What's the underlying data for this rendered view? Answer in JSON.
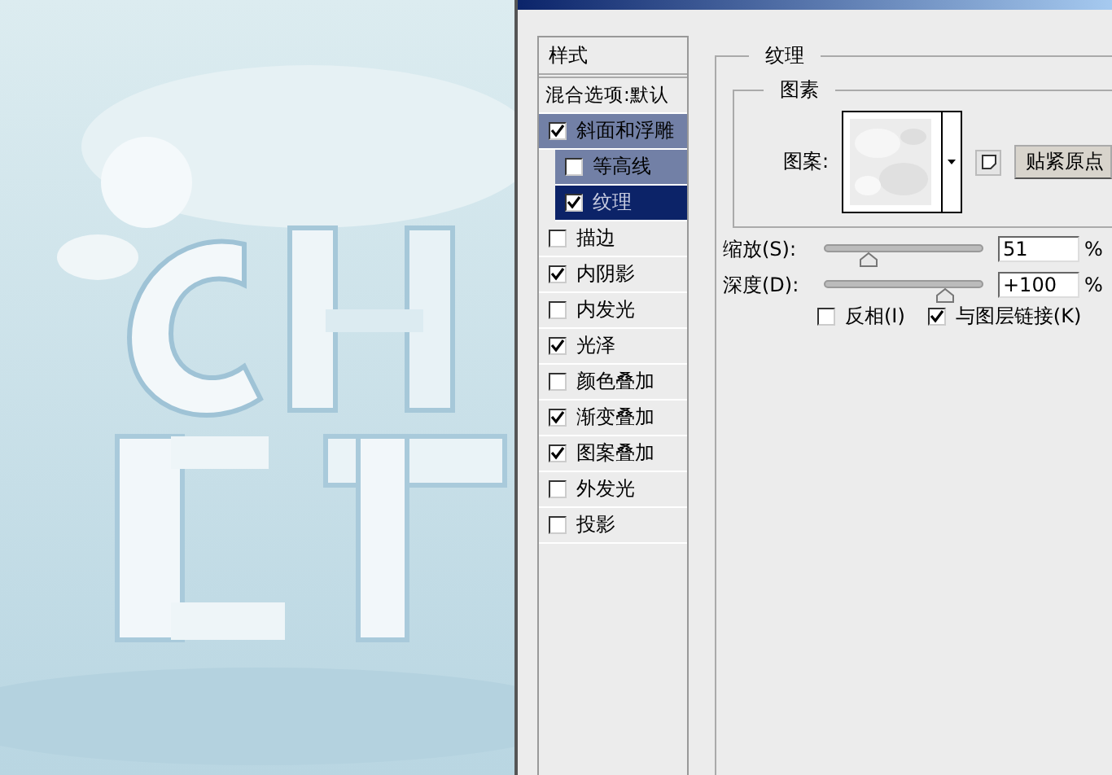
{
  "style_list": {
    "header": "样式",
    "items": [
      {
        "label": "混合选项:默认",
        "kind": "plain",
        "selected": false
      },
      {
        "label": "斜面和浮雕",
        "kind": "checkbox",
        "checked": true,
        "selected": false,
        "children": [
          {
            "label": "等高线",
            "kind": "checkbox",
            "checked": false,
            "selected": false
          },
          {
            "label": "纹理",
            "kind": "checkbox",
            "checked": true,
            "selected": true
          }
        ]
      },
      {
        "label": "描边",
        "kind": "checkbox",
        "checked": false,
        "selected": false
      },
      {
        "label": "内阴影",
        "kind": "checkbox",
        "checked": true,
        "selected": false
      },
      {
        "label": "内发光",
        "kind": "checkbox",
        "checked": false,
        "selected": false
      },
      {
        "label": "光泽",
        "kind": "checkbox",
        "checked": true,
        "selected": false
      },
      {
        "label": "颜色叠加",
        "kind": "checkbox",
        "checked": false,
        "selected": false
      },
      {
        "label": "渐变叠加",
        "kind": "checkbox",
        "checked": true,
        "selected": false
      },
      {
        "label": "图案叠加",
        "kind": "checkbox",
        "checked": true,
        "selected": false
      },
      {
        "label": "外发光",
        "kind": "checkbox",
        "checked": false,
        "selected": false
      },
      {
        "label": "投影",
        "kind": "checkbox",
        "checked": false,
        "selected": false
      }
    ]
  },
  "texture": {
    "title": "纹理",
    "group_title": "图素",
    "pattern_label": "图案:",
    "snap_button": "贴紧原点",
    "sliders": [
      {
        "label": "缩放(S):",
        "level": 0.25,
        "value": "51",
        "unit": "%"
      },
      {
        "label": "深度(D):",
        "level": 0.78,
        "value": "+100",
        "unit": "%"
      }
    ],
    "options": [
      {
        "label": "反相(I)",
        "checked": false
      },
      {
        "label": "与图层链接(K)",
        "checked": true
      }
    ]
  }
}
